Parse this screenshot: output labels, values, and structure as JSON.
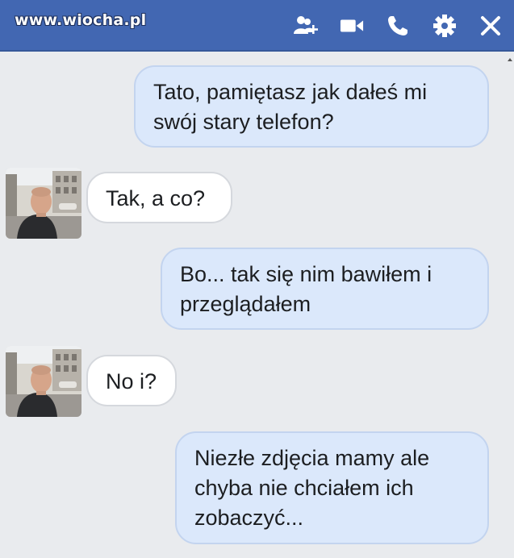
{
  "watermark": "www.wiocha.pl",
  "toolbar": {
    "icons": [
      "add-person-icon",
      "video-call-icon",
      "phone-call-icon",
      "settings-gear-icon",
      "close-icon"
    ]
  },
  "colors": {
    "header": "#4267b2",
    "chat_bg": "#e9ebee",
    "outgoing_bubble": "#dbe8fb",
    "incoming_bubble": "#ffffff"
  },
  "messages": [
    {
      "sender": "me",
      "text": "Tato, pamiętasz jak dałeś mi\nswój stary telefon?"
    },
    {
      "sender": "dad",
      "text": "Tak, a co?"
    },
    {
      "sender": "me",
      "text": "Bo... tak się nim bawiłem i\nprzeglądałem"
    },
    {
      "sender": "dad",
      "text": "No i?"
    },
    {
      "sender": "me",
      "text": "Niezłe zdjęcia mamy ale\nchyba nie chciałem ich\nzobaczyć..."
    }
  ]
}
